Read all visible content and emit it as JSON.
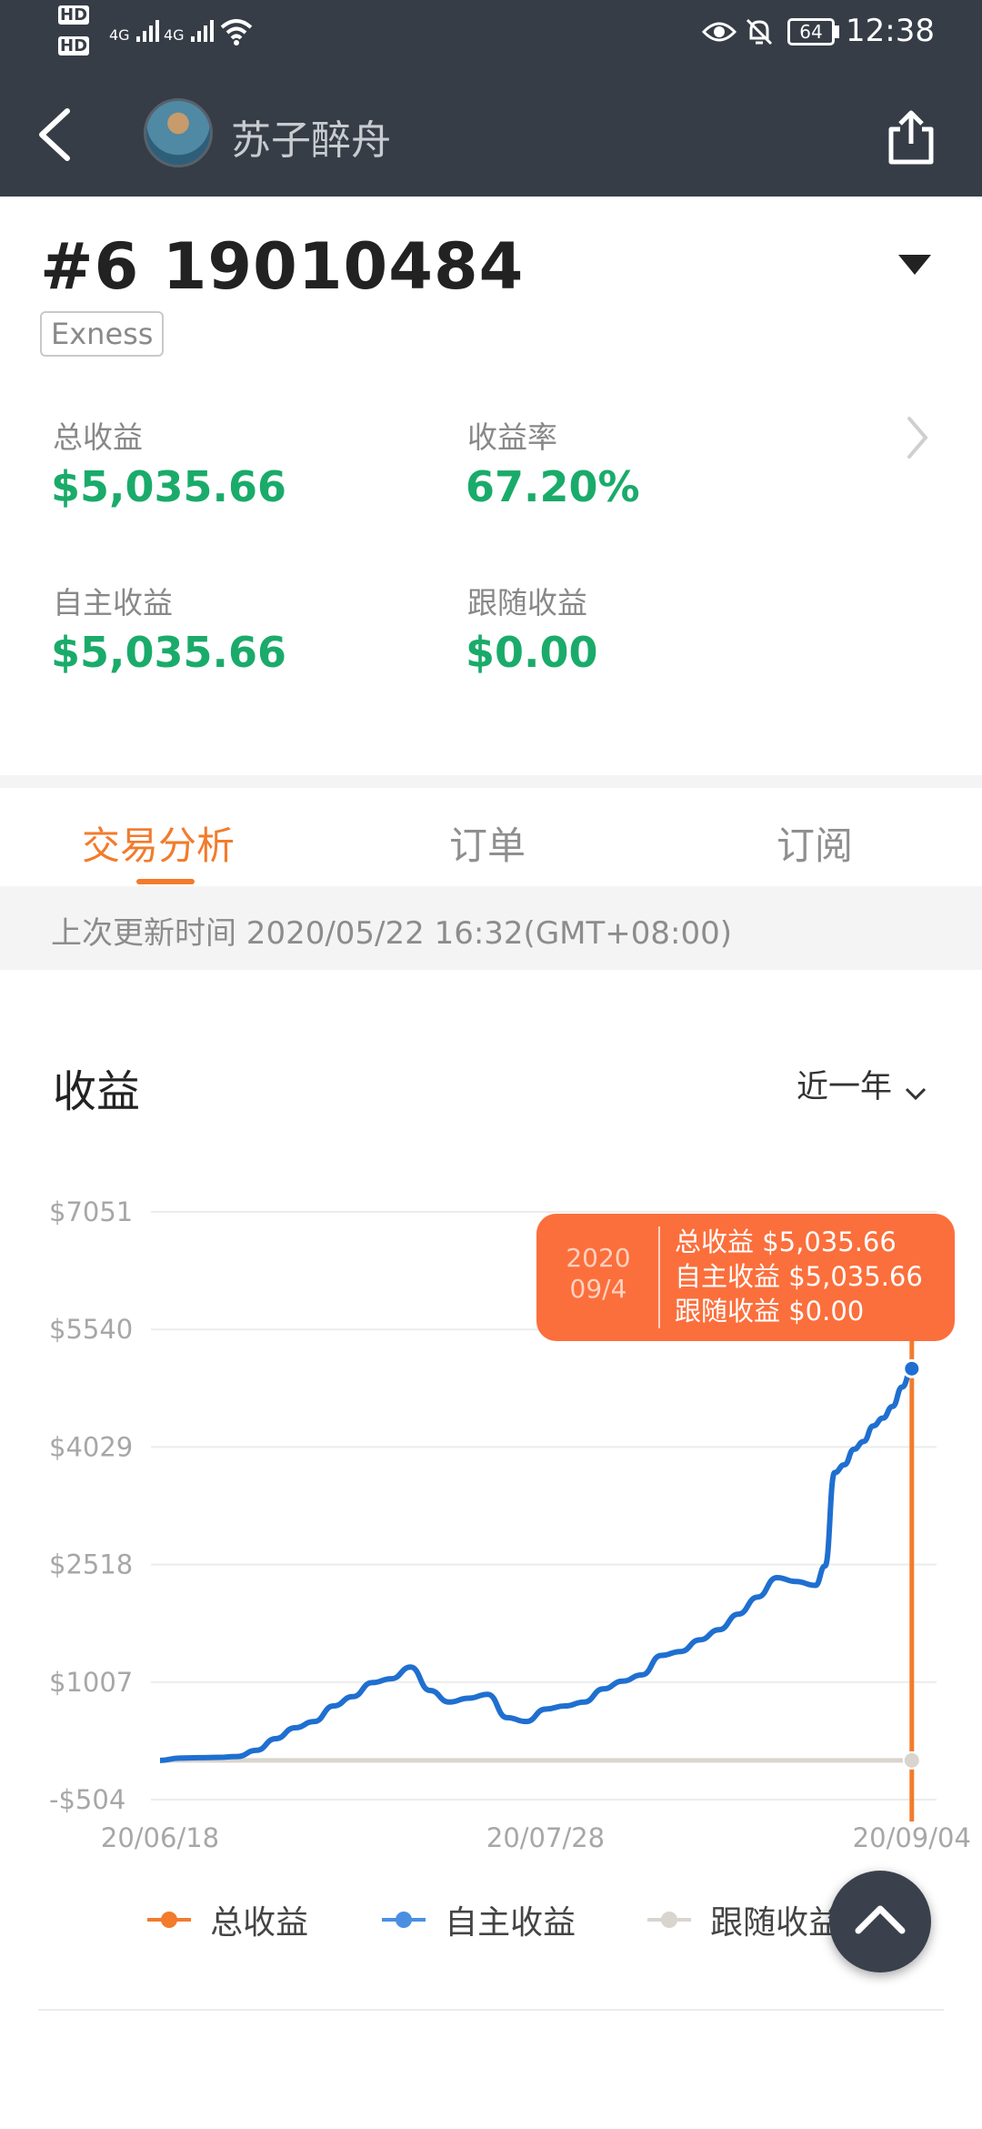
{
  "status_bar": {
    "time": "12:38",
    "battery": "64",
    "hd1": "HD",
    "hd2": "HD",
    "net1": "4G",
    "net2": "4G"
  },
  "nav": {
    "title": "苏子醉舟",
    "back_icon": "chevron-left-icon",
    "share_icon": "share-icon"
  },
  "account": {
    "title": "#6 19010484",
    "broker": "Exness",
    "dropdown_icon": "caret-down-icon"
  },
  "metrics": {
    "total_label": "总收益",
    "total_value": "$5,035.66",
    "rate_label": "收益率",
    "rate_value": "67.20%",
    "self_label": "自主收益",
    "self_value": "$5,035.66",
    "follow_label": "跟随收益",
    "follow_value": "$0.00"
  },
  "tabs": [
    {
      "label": "交易分析",
      "active": true
    },
    {
      "label": "订单",
      "active": false
    },
    {
      "label": "订阅",
      "active": false
    }
  ],
  "update_info": "上次更新时间 2020/05/22 16:32(GMT+08:00)",
  "section": {
    "title": "收益",
    "range_label": "近一年"
  },
  "tooltip": {
    "year": "2020",
    "date": "09/4",
    "total": "总收益 $5,035.66",
    "self": "自主收益 $5,035.66",
    "follow": "跟随收益 $0.00"
  },
  "legend": {
    "total": "总收益",
    "self": "自主收益",
    "follow": "跟随收益"
  },
  "colors": {
    "accent": "#f27b2c",
    "positive": "#1aab6a",
    "self_line": "#1f6fd0",
    "total_line": "#f27b2c",
    "follow_line": "#d9d4ce",
    "tooltip_bg": "#fb6f3c"
  },
  "chart_data": {
    "type": "line",
    "title": "收益",
    "y_ticks": [
      "$7051",
      "$5540",
      "$4029",
      "$2518",
      "$1007",
      "-$504"
    ],
    "y_tick_values": [
      7051,
      5540,
      4029,
      2518,
      1007,
      -504
    ],
    "ylim": [
      -504,
      7051
    ],
    "x_ticks": [
      "20/06/18",
      "20/07/28",
      "20/09/04"
    ],
    "x_tick_days": [
      0,
      40,
      78
    ],
    "xlim": [
      0,
      80
    ],
    "grid": true,
    "legend_position": "bottom",
    "series": [
      {
        "name": "自主收益",
        "color": "#1f6fd0",
        "x": [
          0,
          2,
          4,
          6,
          8,
          10,
          12,
          14,
          16,
          18,
          20,
          22,
          24,
          26,
          28,
          30,
          32,
          34,
          36,
          38,
          40,
          42,
          44,
          46,
          48,
          50,
          52,
          54,
          56,
          58,
          60,
          62,
          64,
          66,
          68,
          69,
          70,
          71,
          72,
          73,
          74,
          75,
          76,
          77,
          78
        ],
        "y": [
          0,
          30,
          35,
          40,
          50,
          130,
          280,
          420,
          500,
          700,
          820,
          1000,
          1050,
          1200,
          900,
          750,
          800,
          850,
          550,
          500,
          660,
          700,
          750,
          920,
          1020,
          1100,
          1350,
          1400,
          1550,
          1680,
          1880,
          2100,
          2350,
          2300,
          2250,
          2500,
          3700,
          3800,
          4000,
          4100,
          4300,
          4400,
          4550,
          4800,
          5035.66
        ]
      },
      {
        "name": "跟随收益",
        "color": "#d9d4ce",
        "x": [
          0,
          78
        ],
        "y": [
          0,
          0
        ]
      }
    ],
    "highlight": {
      "x": 78,
      "date": "2020/09/4",
      "total": 5035.66,
      "self": 5035.66,
      "follow": 0
    }
  }
}
